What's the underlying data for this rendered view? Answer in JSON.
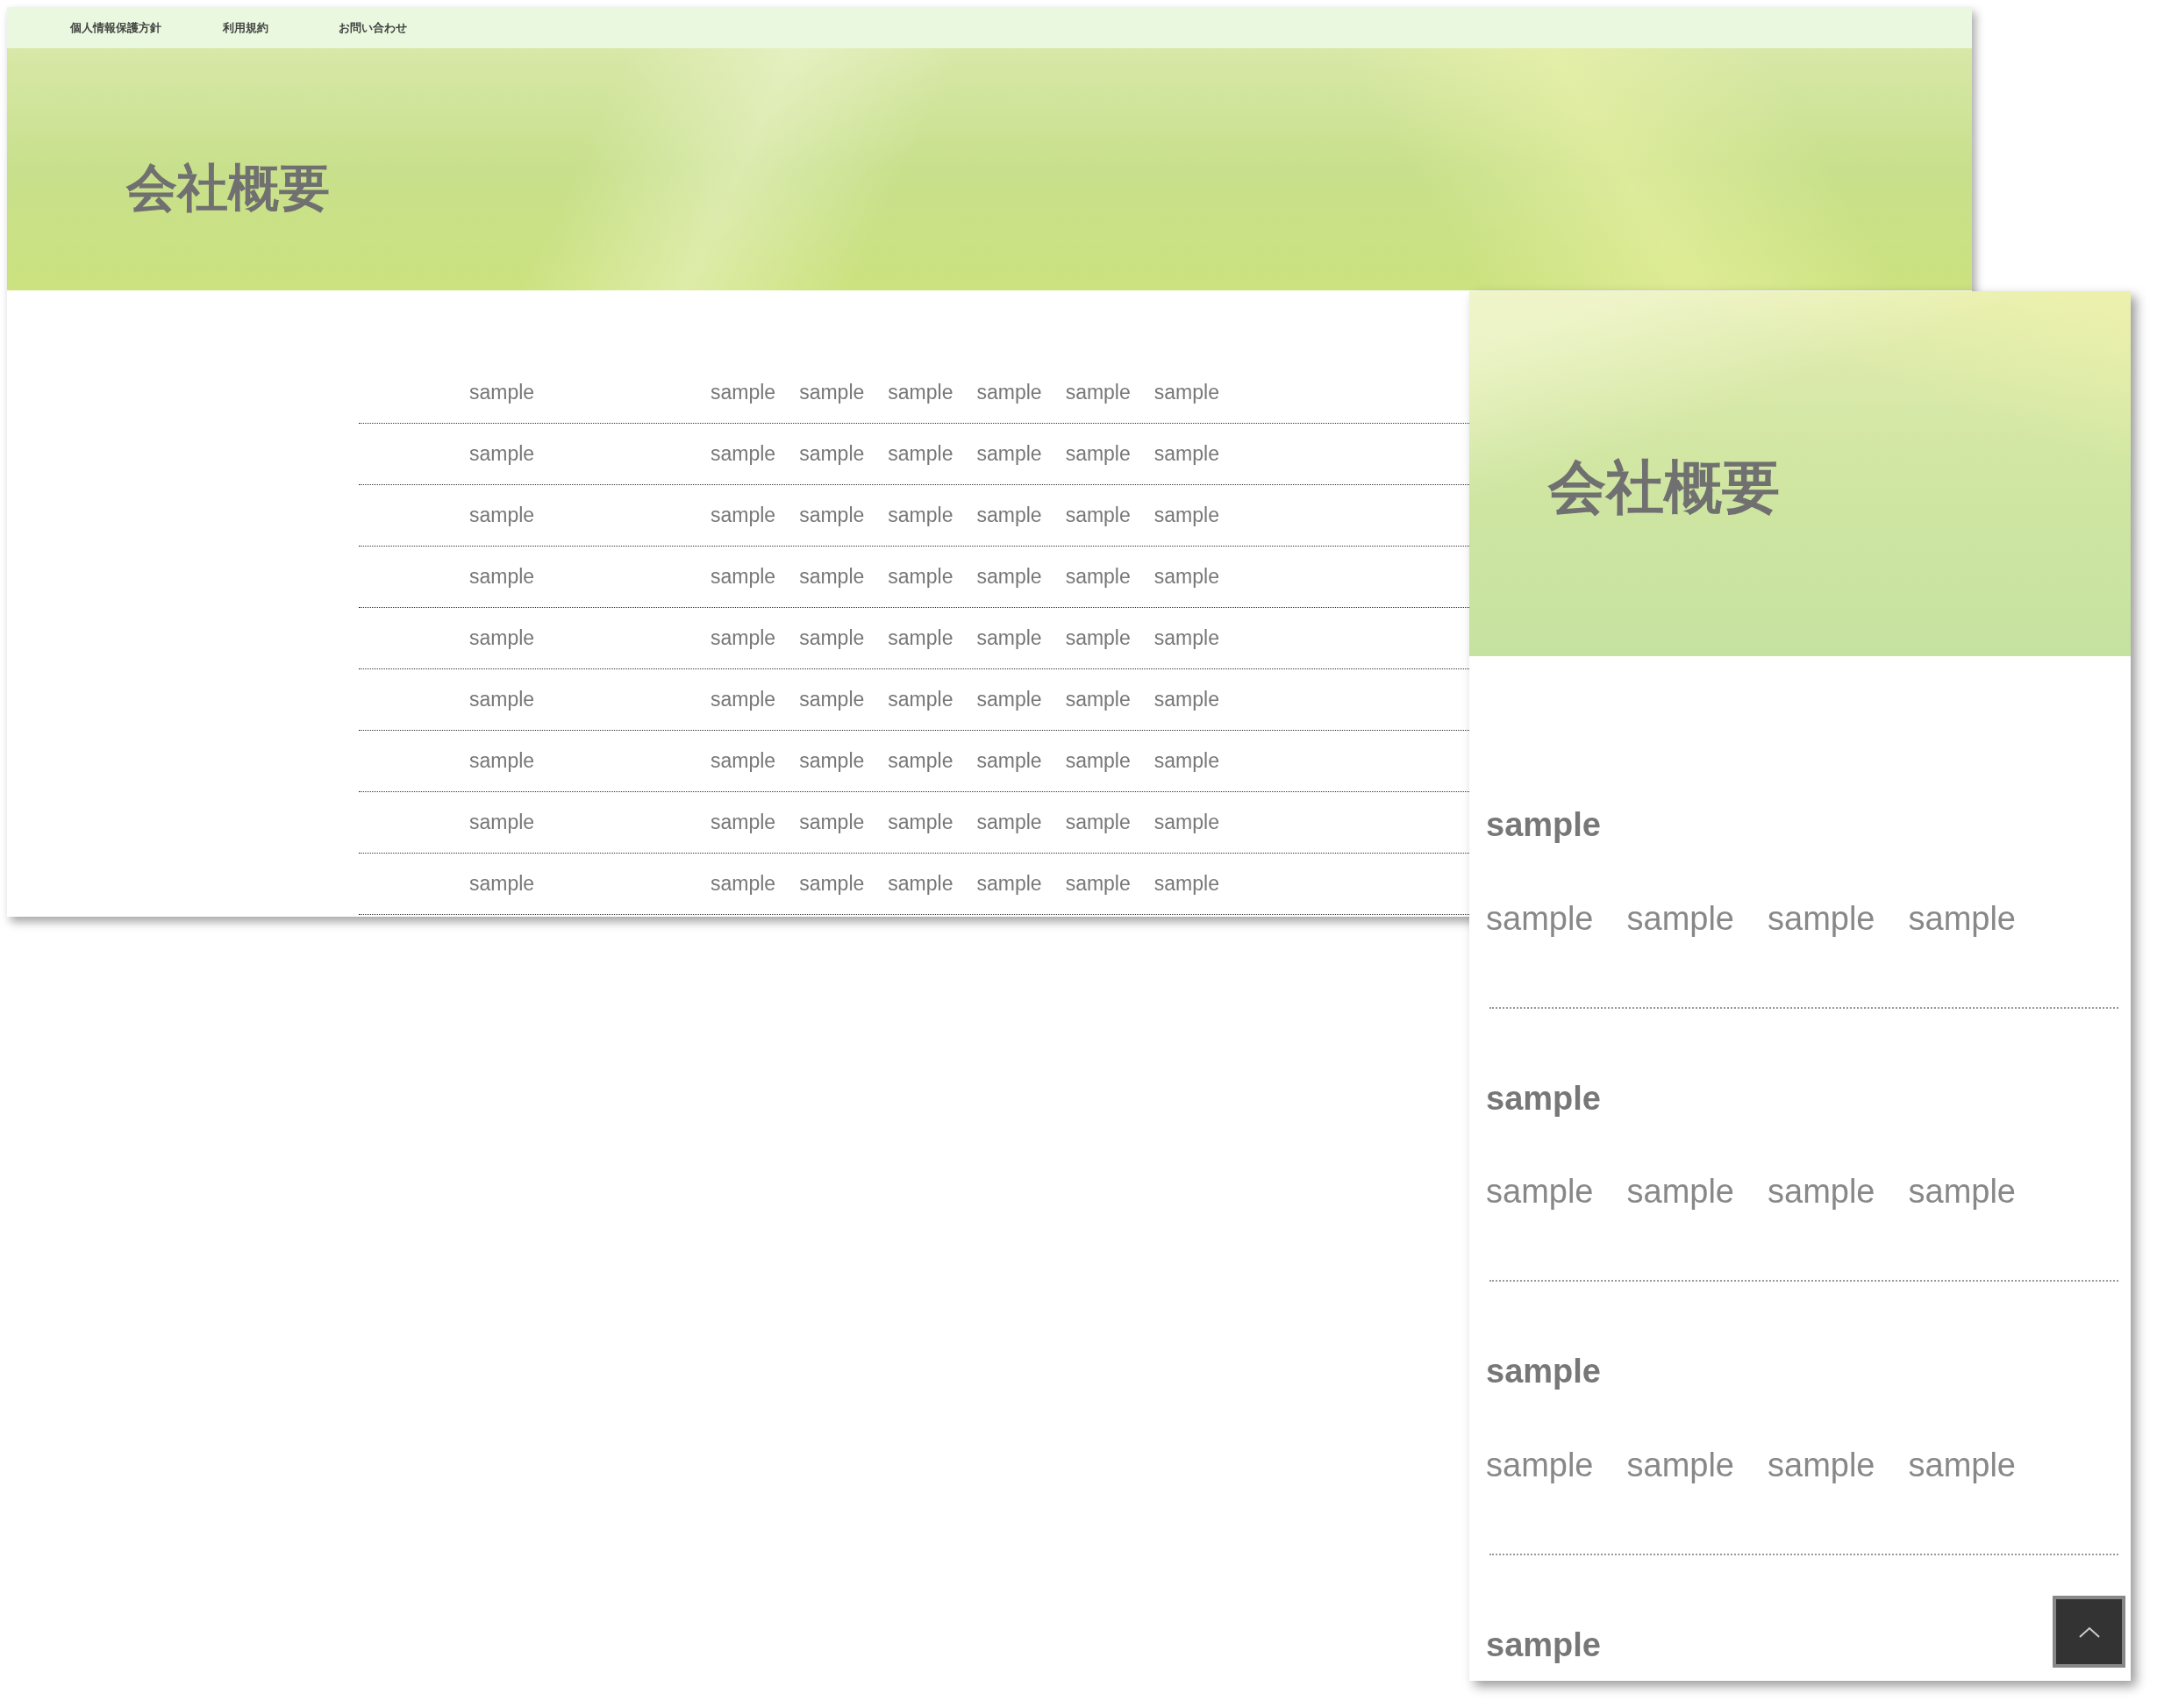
{
  "desktop": {
    "nav_links": [
      "個人情報保護方針",
      "利用規約",
      "お問い合わせ"
    ],
    "hero_title": "会社概要",
    "table": {
      "rows": [
        [
          "sample",
          "sample",
          "sample",
          "sample",
          "sample",
          "sample",
          "sample"
        ],
        [
          "sample",
          "sample",
          "sample",
          "sample",
          "sample",
          "sample",
          "sample"
        ],
        [
          "sample",
          "sample",
          "sample",
          "sample",
          "sample",
          "sample",
          "sample"
        ],
        [
          "sample",
          "sample",
          "sample",
          "sample",
          "sample",
          "sample",
          "sample"
        ],
        [
          "sample",
          "sample",
          "sample",
          "sample",
          "sample",
          "sample",
          "sample"
        ],
        [
          "sample",
          "sample",
          "sample",
          "sample",
          "sample",
          "sample",
          "sample"
        ],
        [
          "sample",
          "sample",
          "sample",
          "sample",
          "sample",
          "sample",
          "sample"
        ],
        [
          "sample",
          "sample",
          "sample",
          "sample",
          "sample",
          "sample",
          "sample"
        ],
        [
          "sample",
          "sample",
          "sample",
          "sample",
          "sample",
          "sample",
          "sample"
        ]
      ]
    }
  },
  "mobile": {
    "hero_title": "会社概要",
    "sections": [
      {
        "heading": "sample",
        "items": [
          "sample",
          "sample",
          "sample",
          "sample"
        ]
      },
      {
        "heading": "sample",
        "items": [
          "sample",
          "sample",
          "sample",
          "sample"
        ]
      },
      {
        "heading": "sample",
        "items": [
          "sample",
          "sample",
          "sample",
          "sample"
        ]
      },
      {
        "heading": "sample"
      }
    ]
  }
}
